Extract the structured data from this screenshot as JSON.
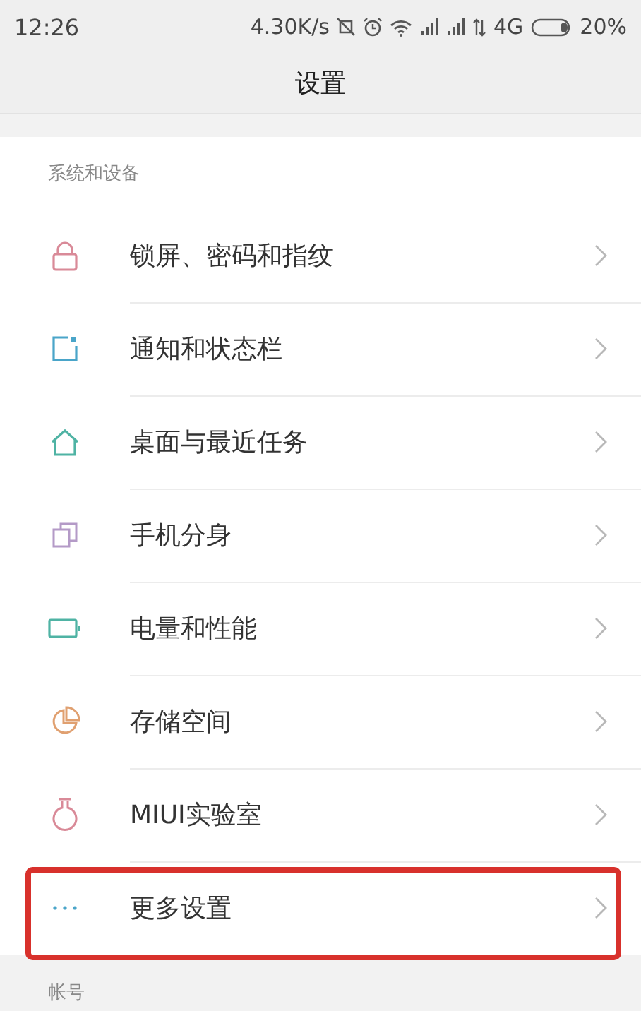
{
  "status_bar": {
    "time": "12:26",
    "speed": "4.30K/s",
    "network": "4G",
    "battery": "20%"
  },
  "title": "设置",
  "section": {
    "header": "系统和设备",
    "items": [
      {
        "label": "锁屏、密码和指纹",
        "color": "#d98a98",
        "highlighted": false
      },
      {
        "label": "通知和状态栏",
        "color": "#4aa5c9",
        "highlighted": false
      },
      {
        "label": "桌面与最近任务",
        "color": "#4fb3a4",
        "highlighted": false
      },
      {
        "label": "手机分身",
        "color": "#b49ac7",
        "highlighted": false
      },
      {
        "label": "电量和性能",
        "color": "#4fb3a4",
        "highlighted": false
      },
      {
        "label": "存储空间",
        "color": "#e0a070",
        "highlighted": false
      },
      {
        "label": "MIUI实验室",
        "color": "#d98a98",
        "highlighted": false
      },
      {
        "label": "更多设置",
        "color": "#4aa5c9",
        "highlighted": true
      }
    ]
  },
  "next_section": {
    "header": "帐号"
  }
}
